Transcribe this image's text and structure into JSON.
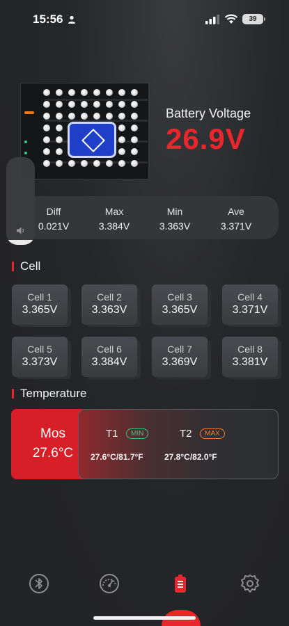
{
  "status_bar": {
    "time": "15:56",
    "battery_level": "39"
  },
  "battery": {
    "label": "Battery Voltage",
    "value": "26.9V"
  },
  "stats": [
    {
      "label": "Diff",
      "value": "0.021V"
    },
    {
      "label": "Max",
      "value": "3.384V"
    },
    {
      "label": "Min",
      "value": "3.363V"
    },
    {
      "label": "Ave",
      "value": "3.371V"
    }
  ],
  "cell_section": {
    "title": "Cell"
  },
  "cells": [
    {
      "name": "Cell 1",
      "voltage": "3.365V"
    },
    {
      "name": "Cell 2",
      "voltage": "3.363V"
    },
    {
      "name": "Cell 3",
      "voltage": "3.365V"
    },
    {
      "name": "Cell 4",
      "voltage": "3.371V"
    },
    {
      "name": "Cell 5",
      "voltage": "3.373V"
    },
    {
      "name": "Cell 6",
      "voltage": "3.384V"
    },
    {
      "name": "Cell 7",
      "voltage": "3.369V"
    },
    {
      "name": "Cell 8",
      "voltage": "3.381V"
    }
  ],
  "temperature_section": {
    "title": "Temperature"
  },
  "temperature": {
    "mos": {
      "label": "Mos",
      "value": "27.6°C"
    },
    "t1": {
      "label": "T1",
      "badge": "MIN",
      "value": "27.6°C/81.7°F"
    },
    "t2": {
      "label": "T2",
      "badge": "MAX",
      "value": "27.8°C/82.0°F"
    }
  },
  "nav": [
    {
      "icon": "bluetooth-icon"
    },
    {
      "icon": "gauge-icon"
    },
    {
      "icon": "battery-list-icon",
      "active": true
    },
    {
      "icon": "gear-icon"
    }
  ],
  "colors": {
    "accent": "#e8262c",
    "min_badge": "#3fbf7f",
    "max_badge": "#ff7a2e",
    "background": "#222326"
  }
}
